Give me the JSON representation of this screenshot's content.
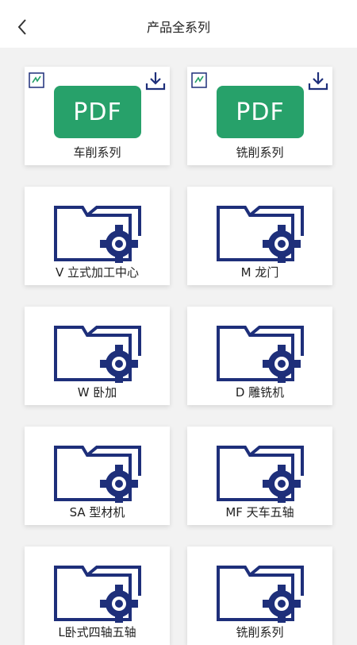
{
  "header": {
    "title": "产品全系列",
    "back_icon": "chevron-left-icon"
  },
  "colors": {
    "pdf_green": "#27a16a",
    "icon_navy": "#1e2f7a"
  },
  "items": [
    {
      "label": "车削系列",
      "type": "pdf"
    },
    {
      "label": "铣削系列",
      "type": "pdf"
    },
    {
      "label": "V 立式加工中心",
      "type": "folder"
    },
    {
      "label": "M 龙门",
      "type": "folder"
    },
    {
      "label": "W 卧加",
      "type": "folder"
    },
    {
      "label": "D 雕铣机",
      "type": "folder"
    },
    {
      "label": "SA 型材机",
      "type": "folder"
    },
    {
      "label": "MF 天车五轴",
      "type": "folder"
    },
    {
      "label": "L卧式四轴五轴",
      "type": "folder"
    },
    {
      "label": "铣削系列",
      "type": "folder"
    }
  ],
  "pdf_badge_text": "PDF"
}
